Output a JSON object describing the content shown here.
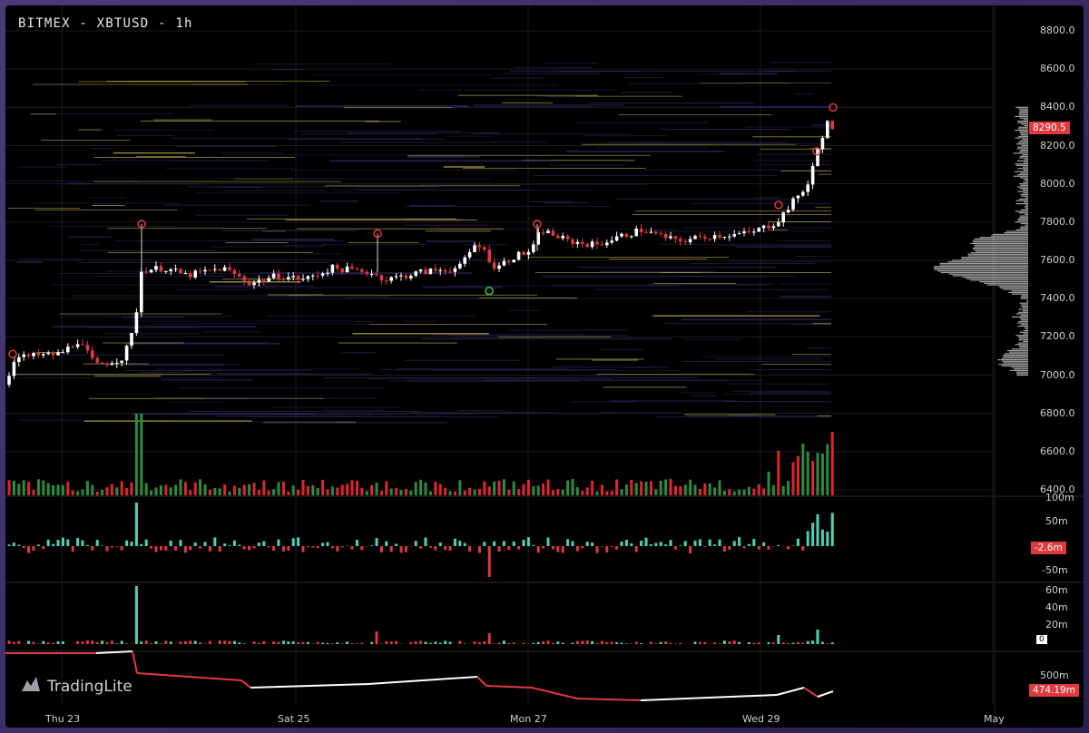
{
  "title": "BITMEX - XBTUSD - 1h",
  "brand": "TradingLite",
  "colors": {
    "up": "#ffffff",
    "down": "#e0393e",
    "volUp": "#2e8b3e",
    "volDown": "#e0262a",
    "delta": "#4fd1b5",
    "grid": "#1c1c24"
  },
  "price_axis": {
    "ticks": [
      "8800.0",
      "8600.0",
      "8400.0",
      "8200.0",
      "8000.0",
      "7800.0",
      "7600.0",
      "7400.0",
      "7200.0",
      "7000.0",
      "6800.0",
      "6600.0",
      "6400.0"
    ],
    "last_price": "8290.5"
  },
  "delta_axis": {
    "ticks": [
      "100m",
      "50m",
      "-50m"
    ],
    "last": "-2.6m"
  },
  "oi_axis": {
    "ticks": [
      "60m",
      "40m",
      "20m"
    ],
    "last": "0"
  },
  "cvd_axis": {
    "ticks": [
      "500m"
    ],
    "last": "474.19m"
  },
  "time_axis": [
    "Thu 23",
    "Sat 25",
    "Mon 27",
    "Wed 29",
    "May"
  ],
  "chart_data": {
    "type": "candlestick",
    "title": "BITMEX - XBTUSD - 1h",
    "ylim": [
      6400,
      8900
    ],
    "closes_sample": [
      6950,
      7100,
      7090,
      7150,
      7060,
      7200,
      7560,
      7540,
      7520,
      7500,
      7530,
      7480,
      7520,
      7560,
      7520,
      7560,
      7520,
      7540,
      7650,
      7530,
      7640,
      7750,
      7700,
      7680,
      7690,
      7720,
      7710,
      7740,
      7760,
      7740,
      7880,
      7990,
      8180,
      8290.5
    ]
  }
}
